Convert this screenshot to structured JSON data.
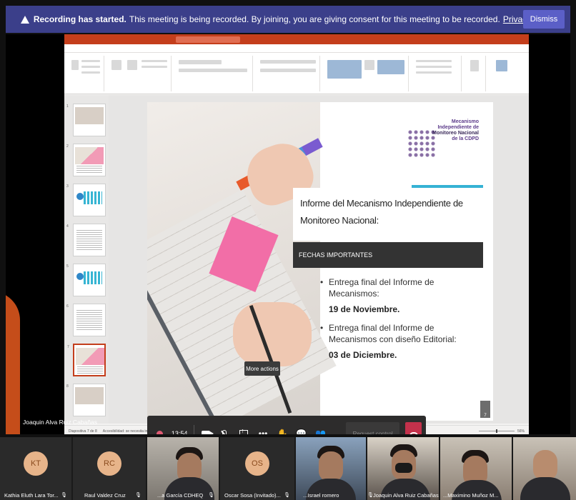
{
  "banner": {
    "title": "Recording has started.",
    "message": "This meeting is being recorded. By joining, you are giving consent for this meeting to be recorded.",
    "link": "Privacy policy",
    "dismiss": "Dismiss"
  },
  "ppt": {
    "slide": {
      "logo_line1": "Mecanismo",
      "logo_line2": "Independiente de",
      "logo_line3": "Monitoreo Nacional",
      "logo_line4": "de la CDPD",
      "title": "Informe del Mecanismo Independiente de Monitoreo Nacional:",
      "section": "FECHAS IMPORTANTES",
      "bullets": [
        {
          "text": "Entrega final del Informe de Mecanismos:",
          "date": "19 de Noviembre."
        },
        {
          "text": "Entrega final del Informe de Mecanismos con diseño Editorial:",
          "date": "03 de Diciembre."
        }
      ],
      "number": "7"
    },
    "status": {
      "slide": "Diapositiva 7 de 8",
      "accessibility": "Accesibilidad: se necesita investigar",
      "zoom": "56%"
    }
  },
  "presenter": "Joaquin Alva Ruiz Cabañas",
  "controls": {
    "time": "13:54",
    "more_tooltip": "More actions",
    "request_control": "Request control",
    "colors": {
      "hangup": "#c4314b",
      "record": "#e05a73"
    }
  },
  "participants": [
    {
      "initials": "KT",
      "name": "Kathia Eluth Lara Tor..."
    },
    {
      "initials": "RC",
      "name": "Raul Valdez Cruz"
    },
    {
      "initials": "",
      "name": "...a García CDHEQ"
    },
    {
      "initials": "OS",
      "name": "Oscar Sosa (Invitado)..."
    },
    {
      "initials": "",
      "name": "...Israel romero"
    },
    {
      "initials": "",
      "name": "Joaquin Alva Ruiz Cabañas"
    },
    {
      "initials": "",
      "name": "...Maximino Muñoz M..."
    },
    {
      "initials": "",
      "name": ""
    }
  ]
}
